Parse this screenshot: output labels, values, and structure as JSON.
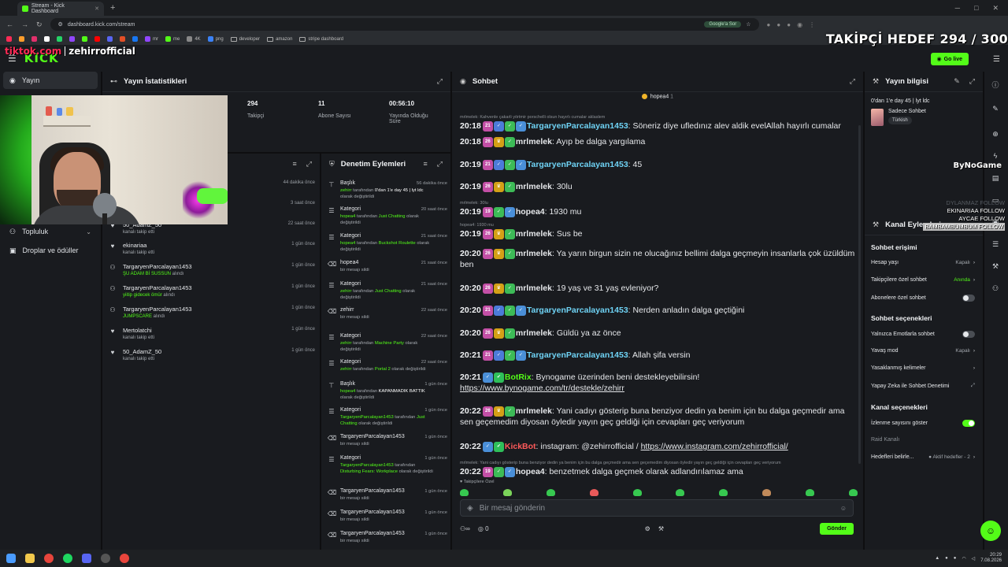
{
  "browser": {
    "tab_title": "Stream - Kick Dashboard",
    "url": "dashboard.kick.com/stream",
    "google_pill": "Google'a Sor",
    "bookmarks": [
      "mr",
      "me",
      "4K",
      "png",
      "developer",
      "amazon",
      "stripe dashboard"
    ]
  },
  "overlay": {
    "follower_goal": "TAKİPÇİ HEDEF 294 / 300",
    "tiktok_prefix": "tiktok.com",
    "tiktok_user": "zehirrofficial",
    "bynogame": "ByNoGame",
    "recent_follows": [
      "BAMBAMBUMBUM FOLLOW",
      "AYCAE FOLLOW",
      "EKINARIAA FOLLOW",
      "DYLANMAZ FOLLOW"
    ]
  },
  "header": {
    "logo": "KICK",
    "go_live": "Go live"
  },
  "leftnav": {
    "items": [
      {
        "label": "Yayın",
        "icon": "broadcast-icon"
      },
      {
        "label": "Topluluk",
        "icon": "people-icon"
      },
      {
        "label": "Droplar ve ödüller",
        "icon": "gift-icon"
      }
    ]
  },
  "stats": {
    "title": "Yayın İstatistikleri",
    "items": [
      {
        "value": "294",
        "label": "Takipçi"
      },
      {
        "value": "11",
        "label": "Abone Sayısı"
      },
      {
        "value": "00:56:10",
        "label": "Yayında Olduğu Süre"
      }
    ]
  },
  "activity": {
    "items": [
      {
        "icon": "",
        "name": "",
        "sub": "",
        "time": "44 dakika önce"
      },
      {
        "icon": "",
        "name": "",
        "sub": "",
        "time": "3 saat önce"
      },
      {
        "icon": "heart",
        "name": "50_AdamZ_50",
        "sub": "kanalı takip etti",
        "time": "22 saat önce"
      },
      {
        "icon": "heart",
        "name": "ekinariaa",
        "sub": "kanalı takip etti",
        "time": "1 gün önce"
      },
      {
        "icon": "reward",
        "name": "TargaryenParcalayan1453",
        "sub_green": "ŞU ADAM Bİ SUSSUN",
        "sub": " alındı",
        "time": "1 gün önce"
      },
      {
        "icon": "reward",
        "name": "TargaryenParcalayan1453",
        "sub_green": "yiitip gidecek ömür",
        "sub": " alındı",
        "time": "1 gün önce"
      },
      {
        "icon": "reward",
        "name": "TargaryenParcalayan1453",
        "sub_green": "JUMPSCARE",
        "sub": " alındı",
        "time": "1 gün önce"
      },
      {
        "icon": "heart",
        "name": "Mertolatchi",
        "sub": "kanalı takip etti",
        "time": "1 gün önce"
      },
      {
        "icon": "heart",
        "name": "50_AdamZ_50",
        "sub": "kanalı takip etti",
        "time": "1 gün önce"
      }
    ]
  },
  "moderation": {
    "title": "Denetim Eylemleri",
    "items": [
      {
        "icon": "text",
        "name": "Başlık",
        "time": "56 dakika önce",
        "parts": [
          [
            "g",
            "zehirr"
          ],
          [
            "n",
            " tarafından "
          ],
          [
            "w",
            "0'dan 1'e day 45 | lyt ldc"
          ],
          [
            "n",
            " olarak değiştirildi"
          ]
        ]
      },
      {
        "icon": "list",
        "name": "Kategori",
        "time": "20 saat önce",
        "parts": [
          [
            "g",
            "hopea4"
          ],
          [
            "n",
            " tarafından "
          ],
          [
            "g",
            "Just Chatting"
          ],
          [
            "n",
            " olarak değiştirildi"
          ]
        ]
      },
      {
        "icon": "list",
        "name": "Kategori",
        "time": "21 saat önce",
        "parts": [
          [
            "g",
            "hopea4"
          ],
          [
            "n",
            " tarafından "
          ],
          [
            "g",
            "Buckshot Roulette"
          ],
          [
            "n",
            " olarak değiştirildi"
          ]
        ]
      },
      {
        "icon": "trash",
        "name": "hopea4",
        "time": "21 saat önce",
        "parts": [
          [
            "n",
            "bir mesajı sildi"
          ]
        ]
      },
      {
        "icon": "list",
        "name": "Kategori",
        "time": "21 saat önce",
        "parts": [
          [
            "g",
            "zehirr"
          ],
          [
            "n",
            " tarafından "
          ],
          [
            "g",
            "Just Chatting"
          ],
          [
            "n",
            " olarak değiştirildi"
          ]
        ]
      },
      {
        "icon": "trash",
        "name": "zehirr",
        "time": "22 saat önce",
        "parts": [
          [
            "n",
            "bir mesajı sildi"
          ]
        ]
      },
      {
        "icon": "list",
        "name": "Kategori",
        "time": "22 saat önce",
        "parts": [
          [
            "g",
            "zehirr"
          ],
          [
            "n",
            " tarafından "
          ],
          [
            "g",
            "Machine Party"
          ],
          [
            "n",
            " olarak değiştirildi"
          ]
        ]
      },
      {
        "icon": "list",
        "name": "Kategori",
        "time": "22 saat önce",
        "parts": [
          [
            "g",
            "zehirr"
          ],
          [
            "n",
            " tarafından "
          ],
          [
            "g",
            "Portal 2"
          ],
          [
            "n",
            " olarak değiştirildi"
          ]
        ]
      },
      {
        "icon": "text",
        "name": "Başlık",
        "time": "1 gün önce",
        "parts": [
          [
            "g",
            "hopea4"
          ],
          [
            "n",
            " tarafından "
          ],
          [
            "w",
            "KAPANMADIK BATTIK"
          ],
          [
            "n",
            " olarak değiştirildi"
          ]
        ]
      },
      {
        "icon": "list",
        "name": "Kategori",
        "time": "1 gün önce",
        "parts": [
          [
            "g",
            "TargaryenParcalayan1453"
          ],
          [
            "n",
            " tarafından "
          ],
          [
            "g",
            "Just Chatting"
          ],
          [
            "n",
            " olarak değiştirildi"
          ]
        ]
      },
      {
        "icon": "trash",
        "name": "TargaryenParcalayan1453",
        "time": "1 gün önce",
        "parts": [
          [
            "n",
            "bir mesajı sildi"
          ]
        ]
      },
      {
        "icon": "list",
        "name": "Kategori",
        "time": "1 gün önce",
        "parts": [
          [
            "g",
            "TargaryenParcalayan1453"
          ],
          [
            "n",
            " tarafından "
          ],
          [
            "g",
            "Disturbing Fears: Workplace"
          ],
          [
            "n",
            " olarak değiştirildi"
          ]
        ]
      },
      {
        "icon": "trash",
        "name": "TargaryenParcalayan1453",
        "time": "1 gün önce",
        "parts": [
          [
            "n",
            "bir mesajı sildi"
          ]
        ]
      },
      {
        "icon": "trash",
        "name": "TargaryenParcalayan1453",
        "time": "1 gün önce",
        "parts": [
          [
            "n",
            "bir mesajı sildi"
          ]
        ]
      },
      {
        "icon": "trash",
        "name": "TargaryenParcalayan1453",
        "time": "1 gün önce",
        "parts": [
          [
            "n",
            "bir mesajı sildi"
          ]
        ]
      }
    ]
  },
  "chat": {
    "title": "Sohbet",
    "pinned": "hopea4",
    "pinned_count": "1",
    "placeholder": "Bir mesaj gönderin",
    "subs_only_label": "Takipçilere Özel",
    "send": "Gönder",
    "points": "0",
    "colors": {
      "targaryen": "#6fd3f5",
      "mrlmelek": "#e6e8eb",
      "hopea4": "#e6e8eb",
      "botrix": "#53fc18",
      "kickbot": "#ff5a5a"
    },
    "messages": [
      {
        "time": "20:18",
        "user": "TargaryenParcalayan1453",
        "color": "targaryen",
        "reply": "mrlmelek: Kahvenle çakarli yörtmir porschelli olsun hayırlı cumalar aklaslem",
        "text": "Söneriz diye ufledınız alev aldik evelAllah hayırlı cumalar",
        "badges": [
          "21",
          "b",
          "g",
          "k"
        ]
      },
      {
        "time": "20:18",
        "user": "mrlmelek",
        "color": "mrlmelek",
        "text": "Ayıp be dalga yargılama",
        "badges": [
          "26",
          "c",
          "g"
        ]
      },
      {
        "time": "20:19",
        "user": "TargaryenParcalayan1453",
        "color": "targaryen",
        "text": "45",
        "badges": [
          "21",
          "b",
          "g",
          "k"
        ]
      },
      {
        "time": "20:19",
        "user": "mrlmelek",
        "color": "mrlmelek",
        "text": "30lu",
        "badges": [
          "26",
          "c",
          "g"
        ]
      },
      {
        "time": "20:19",
        "user": "hopea4",
        "color": "hopea4",
        "reply": "mrlmelek: 30lu",
        "text": "1930 mu",
        "badges": [
          "19",
          "g",
          "k"
        ]
      },
      {
        "time": "20:19",
        "user": "mrlmelek",
        "color": "mrlmelek",
        "reply": "hopea4: 1930 mu",
        "text": "Sus be",
        "badges": [
          "26",
          "c",
          "g"
        ]
      },
      {
        "time": "20:20",
        "user": "mrlmelek",
        "color": "mrlmelek",
        "text": "Ya yarın birgun sizin ne olucağınız bellimi dalga geçmeyin insanlarla çok üzüldüm ben",
        "badges": [
          "26",
          "c",
          "g"
        ]
      },
      {
        "time": "20:20",
        "user": "mrlmelek",
        "color": "mrlmelek",
        "text": "19 yaş ve 31 yaş evleniyor?",
        "badges": [
          "26",
          "c",
          "g"
        ]
      },
      {
        "time": "20:20",
        "user": "TargaryenParcalayan1453",
        "color": "targaryen",
        "text": "Nerden anladın dalga geçtiğini",
        "badges": [
          "21",
          "b",
          "g",
          "k"
        ]
      },
      {
        "time": "20:20",
        "user": "mrlmelek",
        "color": "mrlmelek",
        "text": "Güldü ya az önce",
        "badges": [
          "26",
          "c",
          "g"
        ]
      },
      {
        "time": "20:21",
        "user": "TargaryenParcalayan1453",
        "color": "targaryen",
        "text": "Allah şifa versin",
        "badges": [
          "21",
          "b",
          "g",
          "k"
        ]
      },
      {
        "time": "20:21",
        "user": "BotRix",
        "color": "botrix",
        "text": "Bynogame üzerinden beni destekleyebilirsin!",
        "link": "https://www.bynogame.com/tr/destekle/zehirr",
        "badges": [
          "k",
          "v"
        ]
      },
      {
        "time": "20:22",
        "user": "mrlmelek",
        "color": "mrlmelek",
        "text": "Yani cadıyı gösterip buna benziyor dedin ya benim için bu dalga geçmedir ama sen geçemedim diyosan öyledir yayın geç geldiği için cevapları geç veriyorum",
        "badges": [
          "26",
          "c",
          "g"
        ]
      },
      {
        "time": "20:22",
        "user": "KickBot",
        "color": "kickbot",
        "text": "instagram: @zehirrofficial / ",
        "link": "https://www.instagram.com/zehirrofficial/",
        "badges": [
          "k",
          "v"
        ]
      },
      {
        "time": "20:22",
        "user": "hopea4",
        "color": "hopea4",
        "reply": "mrlmelek: Yani cadıyı gösterip buna benziyor dedin ya benim için bu dalga geçmedir ama sen geçemedim diyosan öyledir yayın geç geldiği için cevapları geç veriyorum",
        "text": "benzetmek dalga geçmek olarak adlandırılamaz ama",
        "badges": [
          "19",
          "g",
          "k"
        ]
      }
    ]
  },
  "stream_info": {
    "title": "Yayın bilgisi",
    "stream_title": "0'dan 1'e day 45 | lyt ldc",
    "category": "Sadece Sohbet",
    "tag": "Türkish"
  },
  "channel_actions": {
    "title": "Kanal Eylemleri",
    "chat_access_title": "Sohbet erişimi",
    "chat_options_title": "Sohbet seçenekleri",
    "channel_options_title": "Kanal seçenekleri",
    "rows_access": [
      {
        "label": "Hesap yaşı",
        "value": "Kapalı",
        "type": "chevron"
      },
      {
        "label": "Takipçilere özel sohbet",
        "value": "Anında",
        "type": "chevron-green"
      },
      {
        "label": "Abonelere özel sohbet",
        "value": "",
        "type": "toggle-off"
      }
    ],
    "rows_chat": [
      {
        "label": "Yalnızca Emotlarla sohbet",
        "value": "",
        "type": "toggle-off"
      },
      {
        "label": "Yavaş mod",
        "value": "Kapalı",
        "type": "chevron"
      },
      {
        "label": "Yasaklanmış kelimeler",
        "value": "",
        "type": "chevron"
      },
      {
        "label": "Yapay Zeka ile Sohbet Denetimi",
        "value": "",
        "type": "external"
      }
    ],
    "rows_channel": [
      {
        "label": "İzlenme sayısını göster",
        "value": "",
        "type": "toggle-on"
      },
      {
        "label": "Raid Kanalı",
        "value": "",
        "type": "none"
      },
      {
        "label": "Hedefleri belirle...",
        "value": "● Aktif hedefler - 2",
        "type": "chevron"
      }
    ]
  },
  "taskbar": {
    "time": "20:29",
    "date": "7.08.2026"
  }
}
